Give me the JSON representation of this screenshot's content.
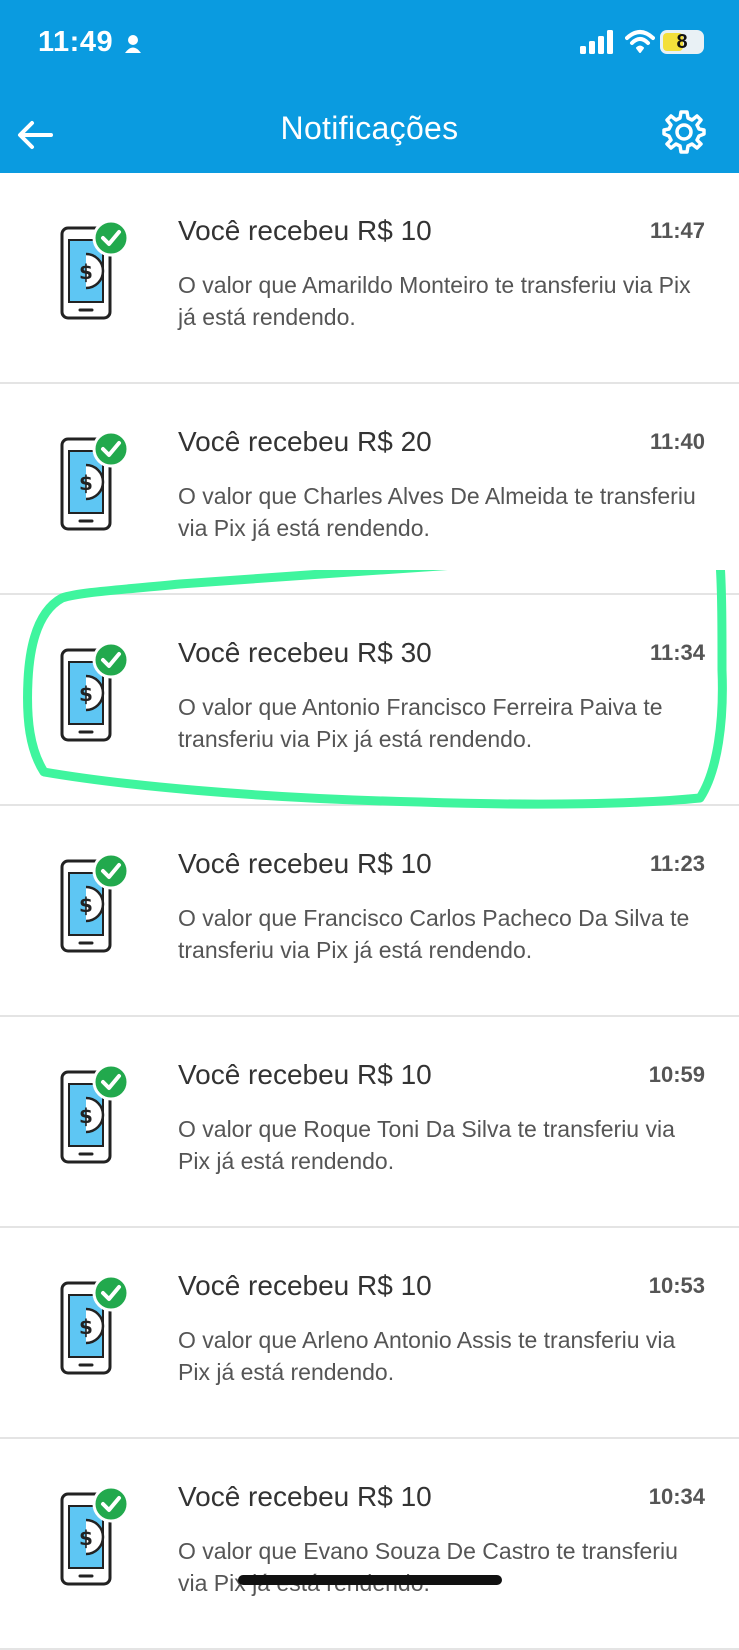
{
  "status_bar": {
    "time": "11:49",
    "battery": "8",
    "icons": [
      "person-icon",
      "signal-icon",
      "wifi-icon",
      "battery-icon"
    ]
  },
  "header": {
    "title": "Notificações",
    "back_icon": "arrow-left-icon",
    "settings_icon": "gear-icon",
    "background": "#0a9be0"
  },
  "notifications": [
    {
      "title": "Você recebeu R$ 10",
      "time": "11:47",
      "body": "O valor que Amarildo Monteiro te transferiu via Pix já está rendendo."
    },
    {
      "title": "Você recebeu R$ 20",
      "time": "11:40",
      "body": "O valor que Charles Alves De Almeida te transferiu via Pix já está rendendo."
    },
    {
      "title": "Você recebeu R$ 30",
      "time": "11:34",
      "body": "O valor que Antonio Francisco Ferreira Paiva te transferiu via Pix já está rendendo."
    },
    {
      "title": "Você recebeu R$ 10",
      "time": "11:23",
      "body": "O valor que Francisco Carlos Pacheco Da Silva te transferiu via Pix já está rendendo."
    },
    {
      "title": "Você recebeu R$ 10",
      "time": "10:59",
      "body": "O valor que Roque Toni Da Silva te transferiu via Pix já está rendendo."
    },
    {
      "title": "Você recebeu R$ 10",
      "time": "10:53",
      "body": "O valor que Arleno Antonio Assis te transferiu via Pix já está rendendo."
    },
    {
      "title": "Você recebeu R$ 10",
      "time": "10:34",
      "body": "O valor que Evano Souza De Castro te transferiu via Pix já está rendendo."
    }
  ],
  "colors": {
    "header": "#0a9be0",
    "highlight_stroke": "#3ff59e",
    "check_badge": "#22a94d",
    "phone_screen": "#5ec6f3"
  }
}
